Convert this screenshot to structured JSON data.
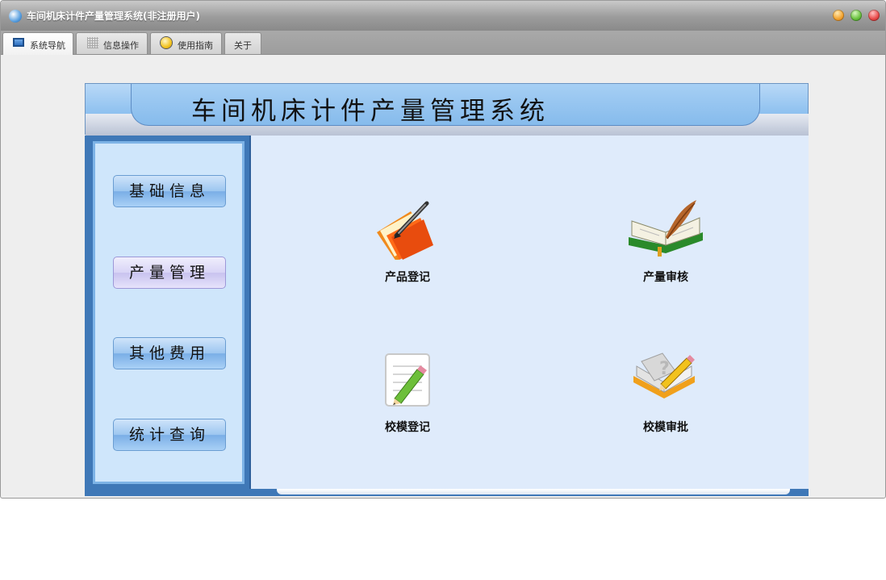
{
  "window": {
    "title": "车间机床计件产量管理系统(非注册用户)"
  },
  "tabs": [
    {
      "label": "系统导航",
      "icon": "monitor-icon",
      "active": true
    },
    {
      "label": "信息操作",
      "icon": "grid-icon",
      "active": false
    },
    {
      "label": "使用指南",
      "icon": "lightbulb-icon",
      "active": false
    },
    {
      "label": "关于",
      "icon": "",
      "active": false
    }
  ],
  "banner": {
    "title": "车间机床计件产量管理系统"
  },
  "sidebar": {
    "items": [
      {
        "label": "基础信息",
        "active": false
      },
      {
        "label": "产量管理",
        "active": true
      },
      {
        "label": "其他费用",
        "active": false
      },
      {
        "label": "统计查询",
        "active": false
      }
    ]
  },
  "functions": [
    {
      "label": "产品登记",
      "icon": "folder-pen-icon"
    },
    {
      "label": "产量审核",
      "icon": "book-quill-icon"
    },
    {
      "label": "校模登记",
      "icon": "notepad-pencil-icon"
    },
    {
      "label": "校模审批",
      "icon": "book-question-icon"
    }
  ],
  "colors": {
    "sidebar_blue": "#3f78b7",
    "content_bg": "#dfebfb",
    "banner_blue": "#8dc0ef"
  }
}
